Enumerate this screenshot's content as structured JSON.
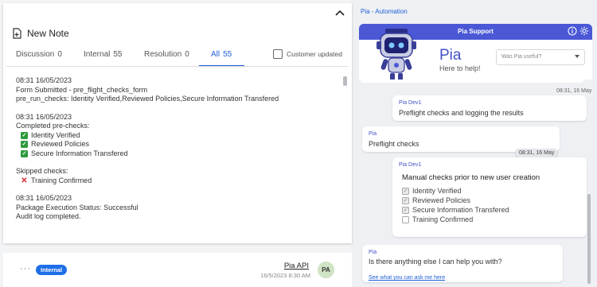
{
  "left": {
    "new_note_label": "New Note",
    "tabs": [
      {
        "label": "Discussion",
        "count": "0"
      },
      {
        "label": "Internal",
        "count": "55"
      },
      {
        "label": "Resolution",
        "count": "0"
      },
      {
        "label": "All",
        "count": "55"
      }
    ],
    "customer_updated_label": "Customer updated",
    "log": {
      "b1": {
        "time": "08:31 16/05/2023",
        "line1": "Form Submitted - pre_flight_checks_form",
        "line2": "pre_run_checks: Identity Verified,Reviewed Policies,Secure Information Transfered"
      },
      "b2": {
        "time": "08:31 16/05/2023",
        "heading": "Completed pre-checks:",
        "items": [
          "Identity Verified",
          "Reviewed Policies",
          "Secure Information Transfered"
        ]
      },
      "b3": {
        "heading": "Skipped checks:",
        "items": [
          "Training Confirmed"
        ]
      },
      "b4": {
        "time": "08:31 16/05/2023",
        "line1": "Package Execution Status: Successful",
        "line2": "Audit log completed."
      }
    },
    "entry": {
      "badge": "Internal",
      "author": "Pia API",
      "datetime": "16/5/2023 8:30 AM",
      "avatar_initials": "PA"
    }
  },
  "right": {
    "panel_title": "Pia - Automation",
    "chat_title": "Pia Support",
    "bot_name": "Pia",
    "bot_tagline": "Here to help!",
    "useful_placeholder": "Was Pia useful?",
    "messages": {
      "ts1": "08:31, 16 May",
      "m1": {
        "sender": "Pia Dev1",
        "text": "Preflight checks and logging the results"
      },
      "m2": {
        "sender": "Pia",
        "text": "Preflight checks"
      },
      "ts_chip": "08:31, 16 May",
      "m3": {
        "sender": "Pia Dev1",
        "title": "Manual checks prior to new user creation",
        "items": [
          {
            "label": "Identity Verified",
            "checked": true
          },
          {
            "label": "Reviewed Policies",
            "checked": true
          },
          {
            "label": "Secure Information Transfered",
            "checked": true
          },
          {
            "label": "Training Confirmed",
            "checked": false
          }
        ]
      },
      "m4": {
        "sender": "Pia",
        "text": "Is there anything else I can help you with?",
        "link": "See what you can ask me here"
      }
    }
  },
  "colors": {
    "accent": "#1f5fd6",
    "header": "#4a58d6",
    "check": "#2e9a3c",
    "cross": "#d32a2a"
  }
}
